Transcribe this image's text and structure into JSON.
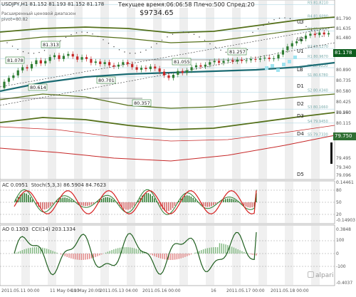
{
  "header": {
    "symbol_line": "USDJPY,H1  81.152 81.193 81.152 81.178",
    "pivot_line_1": "Расширенный ценовой диапазон",
    "pivot_line_2": "pivot=80.82",
    "server_time": "Текущее время:06:06:58 Плечо:500 Спред:20",
    "balance": "$9734.65"
  },
  "main_axis_labels": [
    "81.790",
    "81.635",
    "81.480",
    "81.178",
    "80.890",
    "80.735",
    "80.580",
    "80.425",
    "80.270",
    "80.115",
    "79.960",
    "79.750",
    "79.495",
    "79.340",
    "79.096"
  ],
  "pivot_labels": {
    "R5": "R5 81.8210",
    "R4": "R4 81.6090",
    "R3": "R3 81.4030",
    "R2": "R2 81.1270",
    "R1": "R1 80.9670",
    "PP": "PP 80.8220",
    "S1": "S1 80.6780",
    "S2": "S2 80.4340",
    "S3": "S3 80.1660",
    "S4": "S4 79.9450",
    "S5": "S5 79.7330"
  },
  "level_tags": [
    "U3",
    "U2",
    "U1",
    "LB",
    "D1",
    "D2",
    "D3",
    "D4",
    "D5"
  ],
  "price_marks": [
    "81.078",
    "81.313",
    "80.614",
    "80.701",
    "80.357",
    "81.055",
    "81.257"
  ],
  "current_price": "81.178",
  "support_price": "79.750",
  "ac_panel": {
    "label": "AC 0.0951",
    "stoch_label": "Stoch(5,3,3) 86.5904 84.7623",
    "axis": [
      "0.14461",
      "80",
      "50",
      "20",
      "-0.14903"
    ]
  },
  "ao_panel": {
    "label": "AO 0.1303",
    "cci_label": "CCI(14) 203.1334",
    "axis": [
      "0.3848",
      "100",
      "0",
      "-100",
      "-0.4037"
    ]
  },
  "time_axis": [
    "2011.05.11 00:00",
    "11 May 04:00",
    "11 May 20:00",
    "2011.05.13 04:00",
    "2011.05.16 00:00",
    "16",
    "2011.05.17 00:00",
    "2011.05.18 00:00"
  ],
  "brand": "alpari",
  "colors": {
    "bull": "#2e7d32",
    "bear": "#c62828",
    "ma": "#1b6b73",
    "channel": "#55701a",
    "price_tag": "#0d5d1e",
    "support_tag": "#2f6f33"
  },
  "chart_data": [
    {
      "type": "candlestick",
      "title": "USDJPY,H1",
      "ylim": [
        79.096,
        81.85
      ],
      "last_close": 81.178,
      "marked_prices": [
        81.078,
        81.313,
        80.614,
        80.701,
        80.357,
        81.055,
        81.257
      ]
    },
    {
      "type": "line",
      "title": "AC / Stoch(5,3,3)",
      "stoch_main": 86.5904,
      "stoch_signal": 84.7623,
      "ac_value": 0.0951,
      "ylim": [
        -0.14903,
        0.14461
      ]
    },
    {
      "type": "bar",
      "title": "AO / CCI(14)",
      "ao_value": 0.1303,
      "cci_value": 203.1334,
      "ylim": [
        -0.4037,
        0.3848
      ]
    }
  ]
}
